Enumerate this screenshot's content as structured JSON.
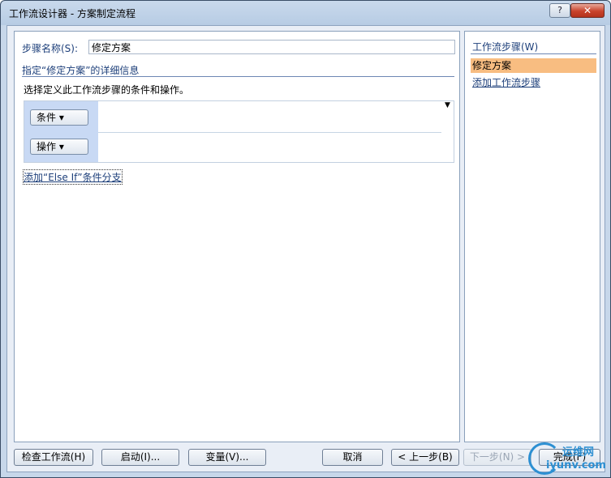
{
  "window": {
    "title": "工作流设计器 - 方案制定流程",
    "help_label": "?",
    "close_label": "✕"
  },
  "main": {
    "step_name_label": "步骤名称(S):",
    "step_name_value": "修定方案",
    "section_title": "指定“修定方案”的详细信息",
    "description": "选择定义此工作流步骤的条件和操作。",
    "condition_button": "条件 ▾",
    "action_button": "操作 ▾",
    "add_else_if_link": "添加“Else If”条件分支"
  },
  "sidebar": {
    "title": "工作流步骤(W)",
    "active_step": "修定方案",
    "add_step_link": "添加工作流步骤"
  },
  "footer": {
    "check_workflow": "检查工作流(H)",
    "initiation": "启动(I)...",
    "variables": "变量(V)...",
    "cancel": "取消",
    "back": "< 上一步(B)",
    "next": "下一步(N) >",
    "finish": "完成(F)"
  },
  "watermark": {
    "line1": "运维网",
    "line2": "iyunv.com"
  }
}
